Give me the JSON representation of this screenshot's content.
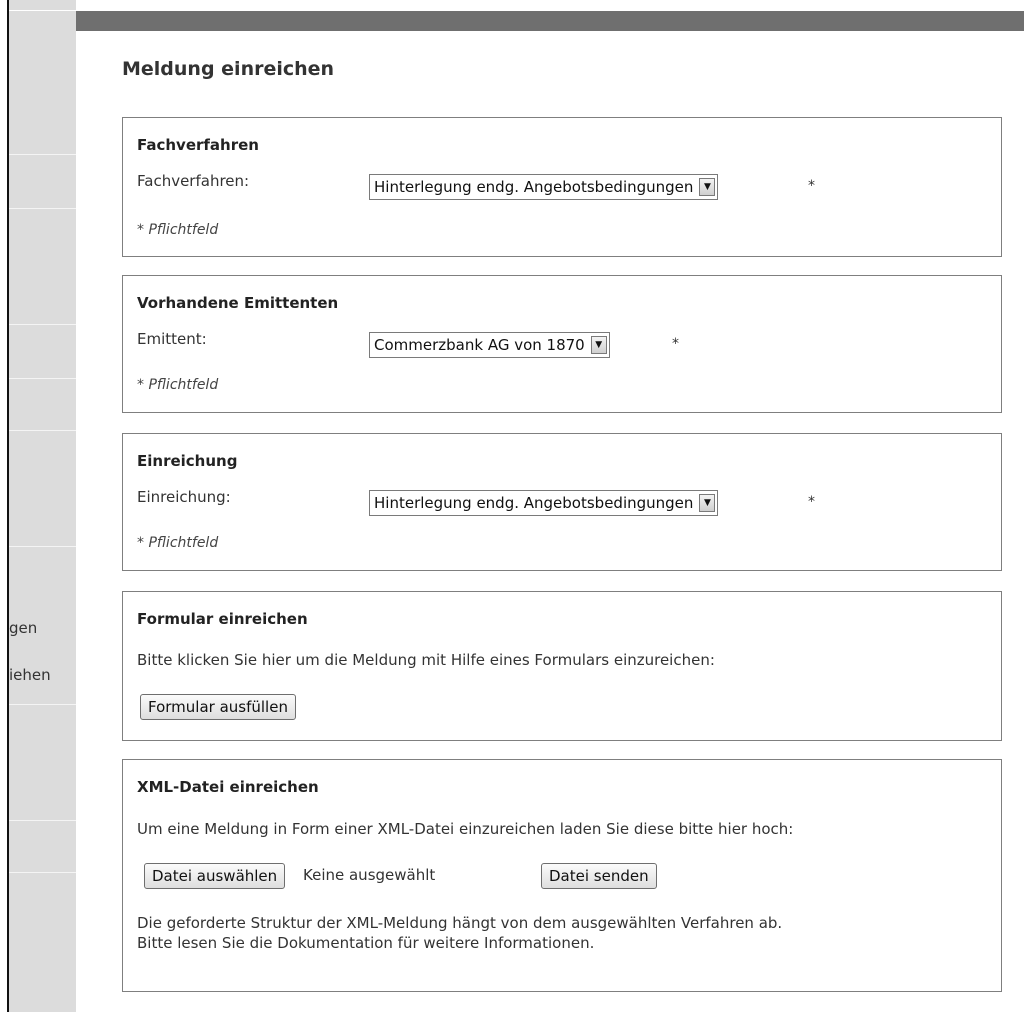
{
  "sidebar": {
    "items": [
      {
        "label": "gen"
      },
      {
        "label": "iehen"
      }
    ]
  },
  "page": {
    "title": "Meldung einreichen"
  },
  "fachverfahren": {
    "heading": "Fachverfahren",
    "label": "Fachverfahren:",
    "selected": "Hinterlegung endg. Angebotsbedingungen",
    "asterisk": "*",
    "required_note": "* Pflichtfeld"
  },
  "emittenten": {
    "heading": "Vorhandene Emittenten",
    "label": "Emittent:",
    "selected": "Commerzbank AG von 1870",
    "asterisk": "*",
    "required_note": "* Pflichtfeld"
  },
  "einreichung": {
    "heading": "Einreichung",
    "label": "Einreichung:",
    "selected": "Hinterlegung endg. Angebotsbedingungen",
    "asterisk": "*",
    "required_note": "* Pflichtfeld"
  },
  "formular": {
    "heading": "Formular einreichen",
    "description": "Bitte klicken Sie hier um die Meldung mit Hilfe eines Formulars einzureichen:",
    "button_label": "Formular ausfüllen"
  },
  "xml": {
    "heading": "XML-Datei einreichen",
    "description": "Um eine Meldung in Form einer XML-Datei einzureichen laden Sie diese bitte hier hoch:",
    "choose_label": "Datei auswählen",
    "no_file_text": "Keine ausgewählt",
    "send_label": "Datei senden",
    "note_line1": "Die geforderte Struktur der XML-Meldung hängt von dem ausgewählten Verfahren ab.",
    "note_line2": "Bitte lesen Sie die Dokumentation für weitere Informationen."
  },
  "icons": {
    "dropdown": "chevron-down-icon"
  }
}
